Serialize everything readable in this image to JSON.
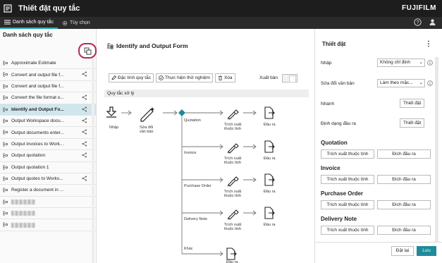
{
  "app": {
    "title": "Thiết đặt quy tắc",
    "brand": "FUJIFILM"
  },
  "tabs": [
    {
      "label": "Danh sách quy tắc"
    },
    {
      "label": "Tùy chọn"
    }
  ],
  "left": {
    "title": "Danh sách quy tắc",
    "rules": [
      {
        "label": "Approximate Estimate",
        "shared": false
      },
      {
        "label": "Convert and output file f...",
        "shared": true
      },
      {
        "label": "Convert and output file f...",
        "shared": false
      },
      {
        "label": "Convert the file format o...",
        "shared": true
      },
      {
        "label": "Identify and Output Fo...",
        "shared": true,
        "selected": true
      },
      {
        "label": "Output Workspace docu...",
        "shared": true
      },
      {
        "label": "Output documents enter...",
        "shared": true
      },
      {
        "label": "Output invoices to Work...",
        "shared": true
      },
      {
        "label": "Output quotation",
        "shared": true
      },
      {
        "label": "Output quotation 1",
        "shared": false
      },
      {
        "label": "Output quotes to Works...",
        "shared": true
      },
      {
        "label": "Register a document in ...",
        "shared": false
      },
      {
        "label": "",
        "shared": false,
        "blurred": true
      },
      {
        "label": "",
        "shared": false,
        "blurred": true
      },
      {
        "label": "",
        "shared": false,
        "blurred": true
      }
    ]
  },
  "center": {
    "form_title": "Identify and Output Form",
    "actions": {
      "properties": "Đặc tính quy tắc",
      "test": "Thực hiện thử nghiệm",
      "delete": "Xóa"
    },
    "export_label": "Xuất bản",
    "section": "Quy tắc xử lý",
    "flow": {
      "input": "Nhập",
      "edit": "Sửa đổi văn bản",
      "branches": [
        "Quotation",
        "Invoice",
        "Purchase Order",
        "Delivery Note",
        "Khác"
      ],
      "extract": "Trích xuất thuộc tính",
      "output": "Đầu ra"
    }
  },
  "right": {
    "title": "Thiết đặt",
    "fields": {
      "input_label": "Nhập",
      "input_value": "Không chỉ định",
      "edit_label": "Sửa đổi văn bản",
      "edit_value": "Làm theo mặc...",
      "branch_label": "Nhánh",
      "branch_btn": "Thiết đặt",
      "format_label": "Định dạng đầu ra",
      "format_btn": "Thiết đặt"
    },
    "sections": [
      {
        "title": "Quotation",
        "extract": "Trích xuất thuộc tính",
        "output": "Đích đầu ra"
      },
      {
        "title": "Invoice",
        "extract": "Trích xuất thuộc tính",
        "output": "Đích đầu ra"
      },
      {
        "title": "Purchase Order",
        "extract": "Trích xuất thuộc tính",
        "output": "Đích đầu ra"
      },
      {
        "title": "Delivery Note",
        "extract": "Trích xuất thuộc tính",
        "output": "Đích đầu ra"
      }
    ],
    "reset": "Đặt lại",
    "save": "Lưu"
  }
}
